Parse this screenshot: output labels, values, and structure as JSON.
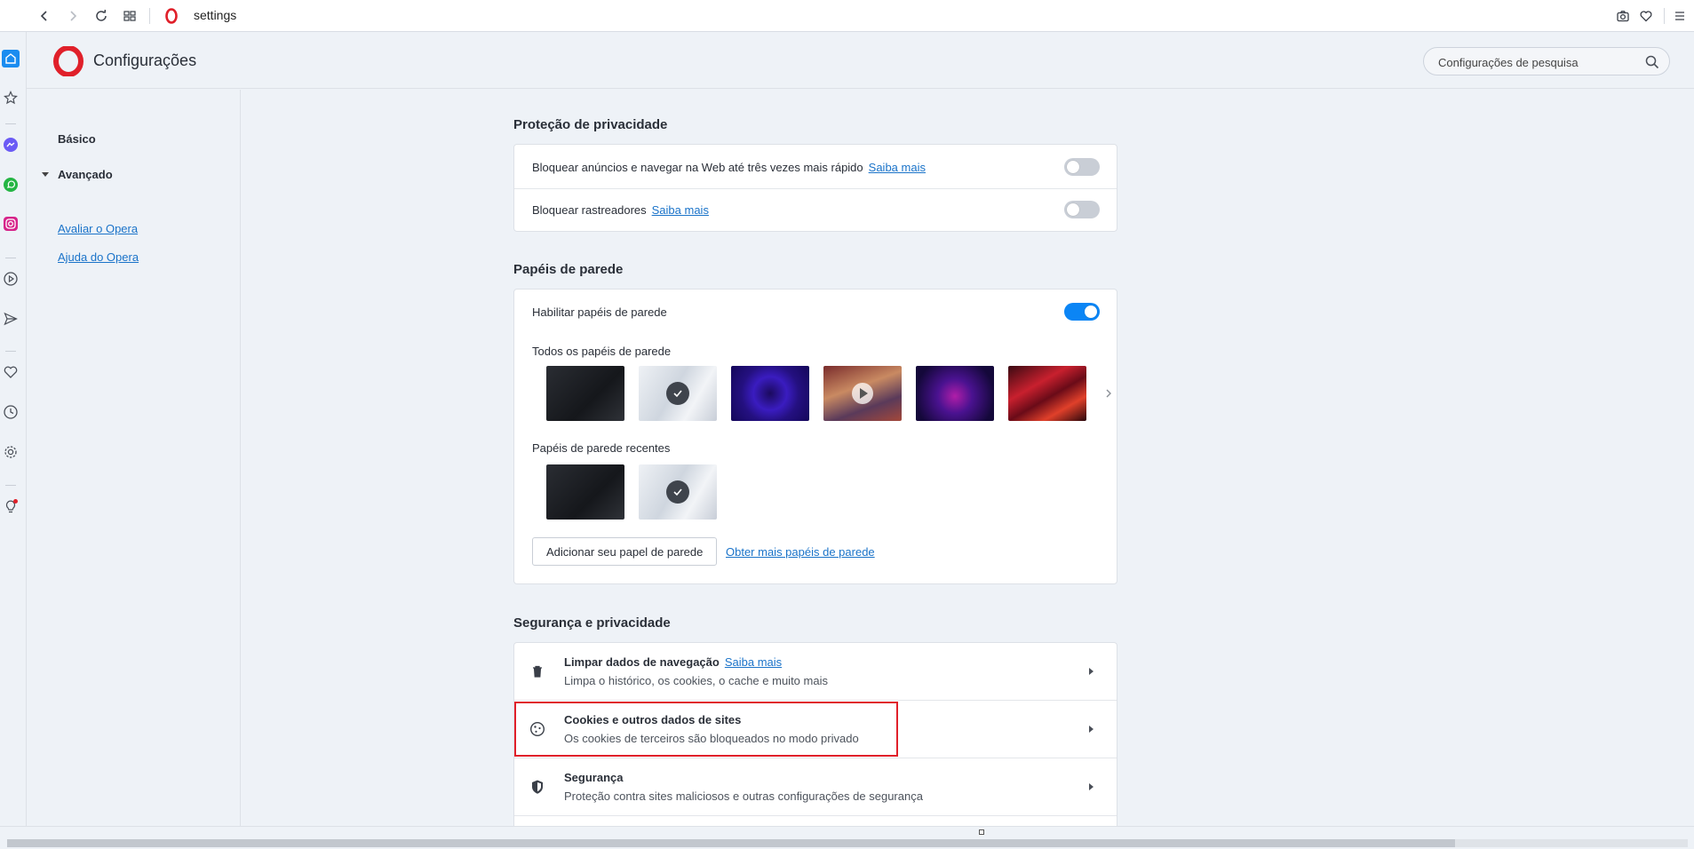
{
  "browser": {
    "url": "settings",
    "accent": "#0b85f5",
    "brand": "#e0202a"
  },
  "header": {
    "title": "Configurações",
    "search_placeholder": "Configurações de pesquisa"
  },
  "nav": {
    "basic": "Básico",
    "advanced": "Avançado",
    "rate": "Avaliar o Opera",
    "help": "Ajuda do Opera"
  },
  "privacy": {
    "title": "Proteção de privacidade",
    "ads_label": "Bloquear anúncios e navegar na Web até três vezes mais rápido",
    "ads_link": "Saiba mais",
    "ads_enabled": false,
    "trackers_label": "Bloquear rastreadores",
    "trackers_link": "Saiba mais",
    "trackers_enabled": false
  },
  "wallpapers": {
    "title": "Papéis de parede",
    "enable_label": "Habilitar papéis de parede",
    "enabled": true,
    "all_label": "Todos os papéis de parede",
    "recent_label": "Papéis de parede recentes",
    "add_button": "Adicionar seu papel de parede",
    "more_link": "Obter mais papéis de parede"
  },
  "security": {
    "title": "Segurança e privacidade",
    "items": [
      {
        "title": "Limpar dados de navegação",
        "link": "Saiba mais",
        "subtitle": "Limpa o histórico, os cookies, o cache e muito mais"
      },
      {
        "title": "Cookies e outros dados de sites",
        "subtitle": "Os cookies de terceiros são bloqueados no modo privado"
      },
      {
        "title": "Segurança",
        "subtitle": "Proteção contra sites maliciosos e outras configurações de segurança"
      }
    ]
  }
}
